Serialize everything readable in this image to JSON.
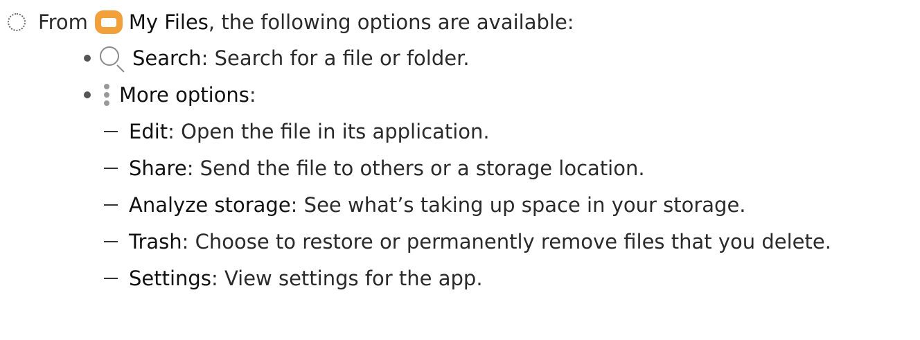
{
  "intro": {
    "prefix": "From",
    "app_name": "My Files",
    "suffix": ", the following options are available:"
  },
  "options": [
    {
      "label": "Search",
      "description": ": Search for a file or folder.",
      "icon": "search-icon"
    },
    {
      "label": "More options",
      "description": ":",
      "icon": "more-options-icon"
    }
  ],
  "more_options": [
    {
      "label": "Edit",
      "description": ": Open the file in its application."
    },
    {
      "label": "Share",
      "description": ": Send the file to others or a storage location."
    },
    {
      "label": "Analyze storage",
      "description": ": See what’s taking up space in your storage."
    },
    {
      "label": "Trash",
      "description": ": Choose to restore or permanently remove files that you delete."
    },
    {
      "label": "Settings",
      "description": ": View settings for the app."
    }
  ],
  "colors": {
    "folder_icon": "#f2a13a",
    "text": "#2a2a2a"
  }
}
